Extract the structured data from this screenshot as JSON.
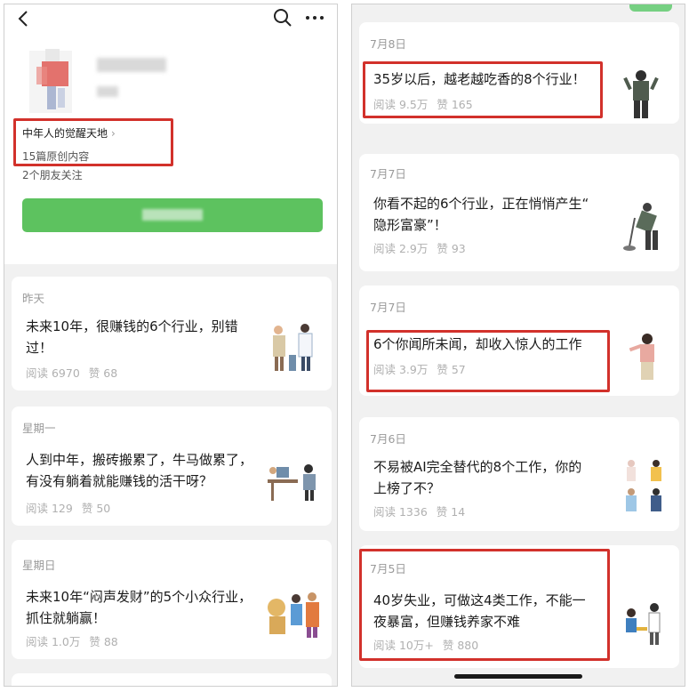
{
  "left": {
    "account": {
      "name": "中年人的觉醒天地",
      "chevron": "›",
      "original_count": "15篇原创内容",
      "friends_following": "2个朋友关注"
    },
    "articles": [
      {
        "date": "昨天",
        "title_line1": "未来10年，很赚钱的6个行业，别错",
        "title_line2": "过！",
        "reads": "阅读 6970",
        "likes": "赞 68"
      },
      {
        "date": "星期一",
        "title_line1": "人到中年，搬砖搬累了，牛马做累了，",
        "title_line2": "有没有躺着就能赚钱的活干呀？",
        "reads": "阅读 129",
        "likes": "赞 50"
      },
      {
        "date": "星期日",
        "title_line1": "未来10年“闷声发财”的5个小众行业，",
        "title_line2": "抓住就躺赢！",
        "reads": "阅读 1.0万",
        "likes": "赞 88"
      }
    ]
  },
  "right": {
    "articles": [
      {
        "date": "7月8日",
        "title_line1": "35岁以后，越老越吃香的8个行业！",
        "title_line2": "",
        "reads": "阅读 9.5万",
        "likes": "赞 165"
      },
      {
        "date": "7月7日",
        "title_line1": "你看不起的6个行业，正在悄悄产生“",
        "title_line2": "隐形富豪”！",
        "reads": "阅读 2.9万",
        "likes": "赞 93"
      },
      {
        "date": "7月7日",
        "title_line1": "6个你闻所未闻，却收入惊人的工作",
        "title_line2": "",
        "reads": "阅读 3.9万",
        "likes": "赞 57"
      },
      {
        "date": "7月6日",
        "title_line1": "不易被AI完全替代的8个工作，你的",
        "title_line2": "上榜了不？",
        "reads": "阅读 1336",
        "likes": "赞 14"
      },
      {
        "date": "7月5日",
        "title_line1": "40岁失业，可做这4类工作，不能一",
        "title_line2": "夜暴富，但赚钱养家不难",
        "reads": "阅读 10万+",
        "likes": "赞 880"
      }
    ]
  },
  "colors": {
    "accent_green": "#5dc25f",
    "highlight_red": "#d2312b",
    "meta_gray": "#b0b0b0"
  },
  "icons": [
    "back-arrow-icon",
    "search-icon",
    "more-icon"
  ]
}
